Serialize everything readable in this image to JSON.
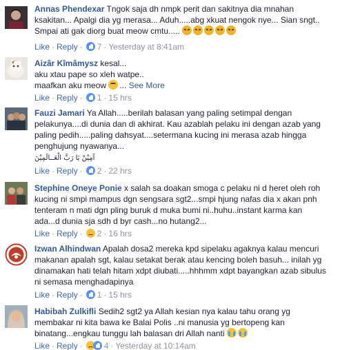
{
  "comments": [
    {
      "author": "Annas Phendexar",
      "lines": [
        "Tngok saja dh nmpk perit dan sakitnya dia mnahan",
        "ksakitan... Apalgi dia yg merasa... Aduh.....abg xkuat nengok nye... Sian sngt..",
        "Smpai ati gak diorg buat meow cmtu....."
      ],
      "emojis": [
        "angry",
        "angry",
        "angry",
        "angry",
        "angry"
      ],
      "like_label": "Like",
      "reply_label": "Reply",
      "reaction": "like",
      "count": "7",
      "time": "Yesterday at 8:41am",
      "avatar": "avatar-person-dark"
    },
    {
      "author": "Aizâr Kîmâmysz",
      "lines": [
        "kesal...",
        "aku xtau pape so xleh watpe..",
        "maafkan aku meow"
      ],
      "emojis": [
        "sad"
      ],
      "see_more": "See More",
      "like_label": "Like",
      "reply_label": "Reply",
      "reaction": "like",
      "count": "1",
      "time": "15 hrs",
      "avatar": "avatar-cat"
    },
    {
      "author": "Fauzi Jamari",
      "lines": [
        "Ya Allah.....berilah balasan yang paling setimpal dengan",
        "pelakunya....di dunia dan di akhirat. Kau azablah pelaku ini dengan azab yang",
        "paling pedih.....paling dahsyat....setermana kucing ini merasa azab hingga",
        "penghujung nyawanya..."
      ],
      "arabic": "آمِيْنْ يَا رَبَّ الْعَــالَمِيْنَ",
      "like_label": "Like",
      "reply_label": "Reply",
      "reaction": "like",
      "count": "2",
      "time": "22 hrs",
      "avatar": "avatar-group"
    },
    {
      "author": "Stephine Oneye Ponie",
      "lines": [
        "x salah sa doakan smoga c pelaku ni d heret oleh roh",
        "kucing ni smpi mampus dgn sengsara sgt2...smpi hjung nafas dia x akan pnh",
        "tenteram n mati dgn pling buruk d muka bumi ni..huhu..instant karma kan",
        "ada...d dunia sja sdh d byr cash...no hutang2..."
      ],
      "like_label": "Like",
      "reply_label": "Reply",
      "reaction": "sad",
      "count": "2",
      "time": "16 hrs",
      "avatar": "avatar-group-2"
    },
    {
      "author": "Izwan Alhindwan",
      "lines": [
        "Apalah dosa2 mereka kpd sipelaku agaknya kalau mencuri",
        "makanan apalah sgt, kalau setakat berak atau kencing boleh basuh... inilah yg",
        "dinamakan hati telah hitam xdpt diubati.....hhhmm xdpt bayangkan azab sibulus",
        "ni semasa menghadapinya"
      ],
      "like_label": "Like",
      "reply_label": "Reply",
      "reaction": "like",
      "count": "1",
      "time": "15 hrs",
      "avatar": "avatar-emblem"
    },
    {
      "author": "Habibah Zulkifli",
      "lines": [
        "Sedih2 sgt2 ya Allah kesian nya kalau tahu orang yg",
        "membakar ni kita bawa ke Balai Polis ..ni manusia yg bertopeng kan",
        "binatang...engkau tunggu lah balasan dri Allah nanti"
      ],
      "emojis": [
        "crying",
        "crying"
      ],
      "like_label": "Like",
      "reply_label": "Reply",
      "reaction": "sad-like",
      "count": "4",
      "time": "Yesterday at 10:14am",
      "avatar": "avatar-hijab"
    }
  ]
}
